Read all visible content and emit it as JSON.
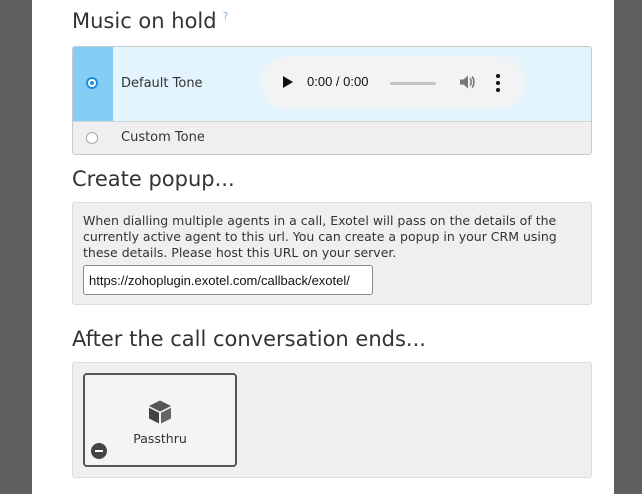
{
  "music_on_hold": {
    "title": "Music on hold",
    "help": "?",
    "options": [
      {
        "label": "Default Tone",
        "selected": true
      },
      {
        "label": "Custom Tone",
        "selected": false
      }
    ],
    "player": {
      "time": "0:00 / 0:00"
    }
  },
  "create_popup": {
    "title": "Create popup...",
    "description": "When dialling multiple agents in a call, Exotel will pass on the details of the currently active agent to this url. You can create a popup in your CRM using these details. Please host this URL on your server.",
    "url_value": "https://zohoplugin.exotel.com/callback/exotel/"
  },
  "after_call": {
    "title": "After the call conversation ends...",
    "applet": {
      "label": "Passthru",
      "icon": "cube-icon"
    }
  },
  "colors": {
    "selected_row": "#e3f4fd",
    "radio_cell": "#86cdf5",
    "radio": "#1a8fe0"
  }
}
